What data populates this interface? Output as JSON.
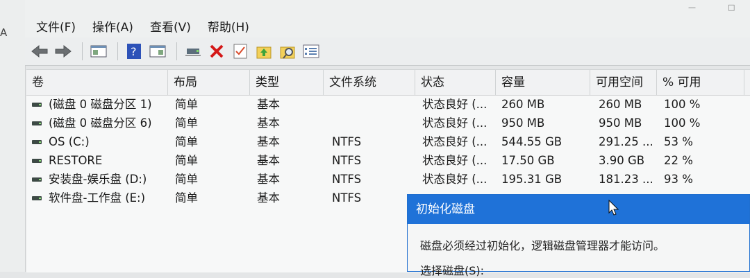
{
  "left_strip_char": "A",
  "menu": [
    "文件(F)",
    "操作(A)",
    "查看(V)",
    "帮助(H)"
  ],
  "toolbar_icons": [
    "back-arrow-icon",
    "forward-arrow-icon",
    "console-tree-icon",
    "help-icon",
    "details-pane-icon",
    "connect-icon",
    "delete-icon",
    "properties-icon",
    "folder-up-icon",
    "search-folder-icon",
    "list-view-icon"
  ],
  "columns": [
    "卷",
    "布局",
    "类型",
    "文件系统",
    "状态",
    "容量",
    "可用空间",
    "% 可用"
  ],
  "rows": [
    {
      "name": "(磁盘 0 磁盘分区 1)",
      "layout": "简单",
      "type": "基本",
      "fs": "",
      "status": "状态良好 (...",
      "capacity": "260 MB",
      "free": "260 MB",
      "pct": "100 %"
    },
    {
      "name": "(磁盘 0 磁盘分区 6)",
      "layout": "简单",
      "type": "基本",
      "fs": "",
      "status": "状态良好 (...",
      "capacity": "950 MB",
      "free": "950 MB",
      "pct": "100 %"
    },
    {
      "name": "OS (C:)",
      "layout": "简单",
      "type": "基本",
      "fs": "NTFS",
      "status": "状态良好 (...",
      "capacity": "544.55 GB",
      "free": "291.25 ...",
      "pct": "53 %"
    },
    {
      "name": "RESTORE",
      "layout": "简单",
      "type": "基本",
      "fs": "NTFS",
      "status": "状态良好 (...",
      "capacity": "17.50 GB",
      "free": "3.90 GB",
      "pct": "22 %"
    },
    {
      "name": "安装盘-娱乐盘 (D:)",
      "layout": "简单",
      "type": "基本",
      "fs": "NTFS",
      "status": "状态良好 (...",
      "capacity": "195.31 GB",
      "free": "181.23 ...",
      "pct": "93 %"
    },
    {
      "name": "软件盘-工作盘 (E:)",
      "layout": "简单",
      "type": "基本",
      "fs": "NTFS",
      "status": "",
      "capacity": "",
      "free": "",
      "pct": ""
    }
  ],
  "dialog": {
    "title": "初始化磁盘",
    "message": "磁盘必须经过初始化，逻辑磁盘管理器才能访问。",
    "select_label": "选择磁盘(S):"
  },
  "colors": {
    "dialog_title_bg": "#1f72d8",
    "window_bg": "#e4e6e7"
  }
}
